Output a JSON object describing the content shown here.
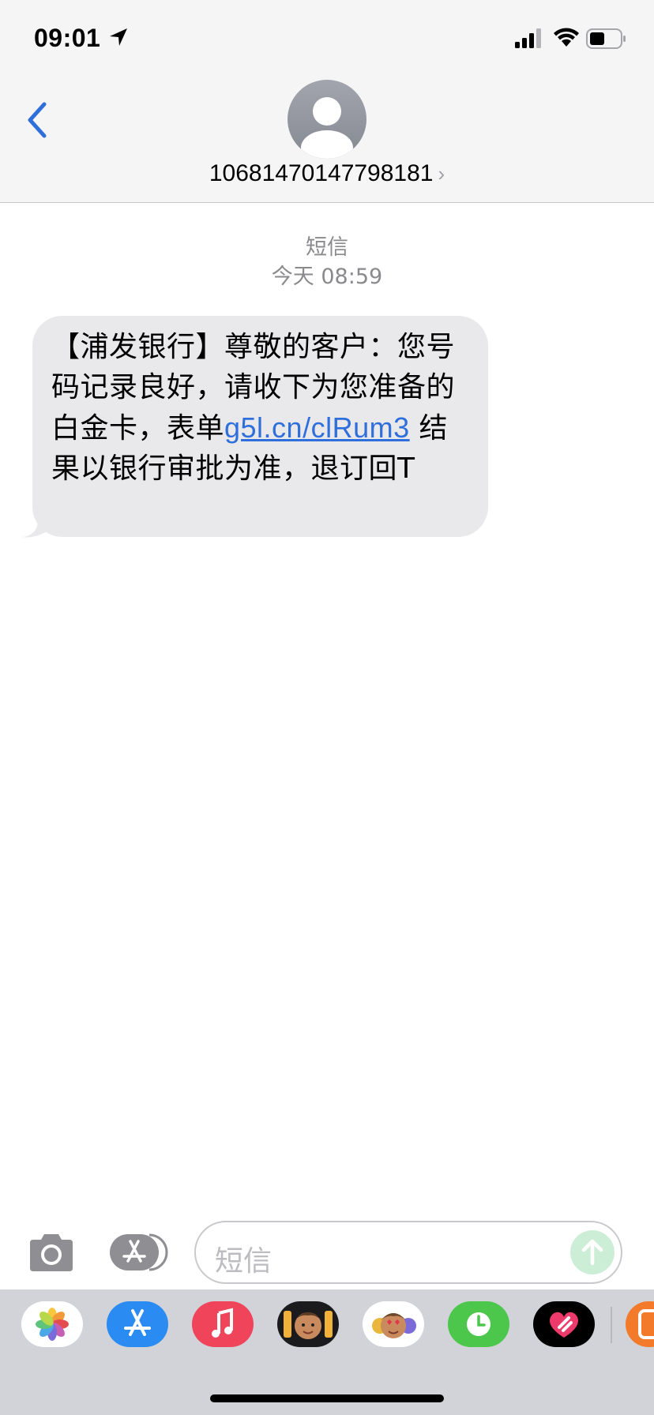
{
  "status": {
    "time": "09:01"
  },
  "header": {
    "contact_number": "10681470147798181",
    "chevron": "›"
  },
  "conversation": {
    "type_label": "短信",
    "timestamp": "今天 08:59",
    "message": {
      "part1": "【浦发银行】尊敬的客户：您号码记录良好，请收下为您准备的白金卡，表单",
      "link": "g5l.cn/clRum3",
      "part2": " 结果以银行审批为准，退订回T"
    }
  },
  "input": {
    "placeholder": "短信"
  },
  "drawer": {
    "apps": [
      "photos-icon",
      "app-store-icon",
      "music-icon",
      "memoji-icon",
      "animoji-icon",
      "activity-icon",
      "heart-icon",
      "more-app-icon"
    ]
  },
  "colors": {
    "accent": "#2f6fdb",
    "bubble": "#e9e9eb",
    "send": "#cdeed6"
  }
}
